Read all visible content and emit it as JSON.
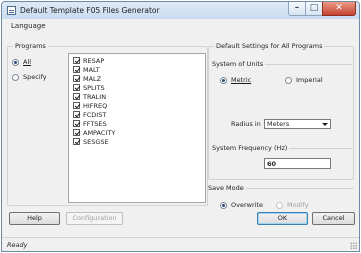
{
  "window": {
    "title": "Default Template F05 Files Generator",
    "controls": {
      "minimize": "–",
      "maximize": "□",
      "close": "✕"
    }
  },
  "menubar": {
    "items": [
      {
        "label": "Language"
      }
    ]
  },
  "programs": {
    "group_label": "Programs",
    "options": [
      {
        "label": "All",
        "checked": true
      },
      {
        "label": "Specify",
        "checked": false
      }
    ],
    "items": [
      {
        "label": "RESAP",
        "checked": true
      },
      {
        "label": "MALT",
        "checked": true
      },
      {
        "label": "MALZ",
        "checked": true
      },
      {
        "label": "SPLITS",
        "checked": true
      },
      {
        "label": "TRALIN",
        "checked": true
      },
      {
        "label": "HIFREQ",
        "checked": true
      },
      {
        "label": "FCDIST",
        "checked": true
      },
      {
        "label": "FFTSES",
        "checked": true
      },
      {
        "label": "AMPACITY",
        "checked": true
      },
      {
        "label": "SESGSE",
        "checked": true
      }
    ]
  },
  "defaults": {
    "group_label": "Default Settings for All Programs",
    "units": {
      "label": "System of Units",
      "metric": "Metric",
      "imperial": "Imperial",
      "selected": "Metric",
      "radius_label": "Radius in",
      "radius_value": "Meters"
    },
    "frequency": {
      "label": "System Frequency (Hz)",
      "value": "60"
    }
  },
  "save_mode": {
    "label": "Save Mode",
    "overwrite": "Overwrite",
    "modify": "Modify",
    "selected": "Overwrite"
  },
  "buttons": {
    "help": "Help",
    "configuration": "Configuration",
    "ok": "OK",
    "cancel": "Cancel"
  },
  "status": {
    "text": "Ready"
  },
  "colors": {
    "accent": "#2b4e7a",
    "titlebar": "#c9dcef",
    "close": "#c74230"
  }
}
